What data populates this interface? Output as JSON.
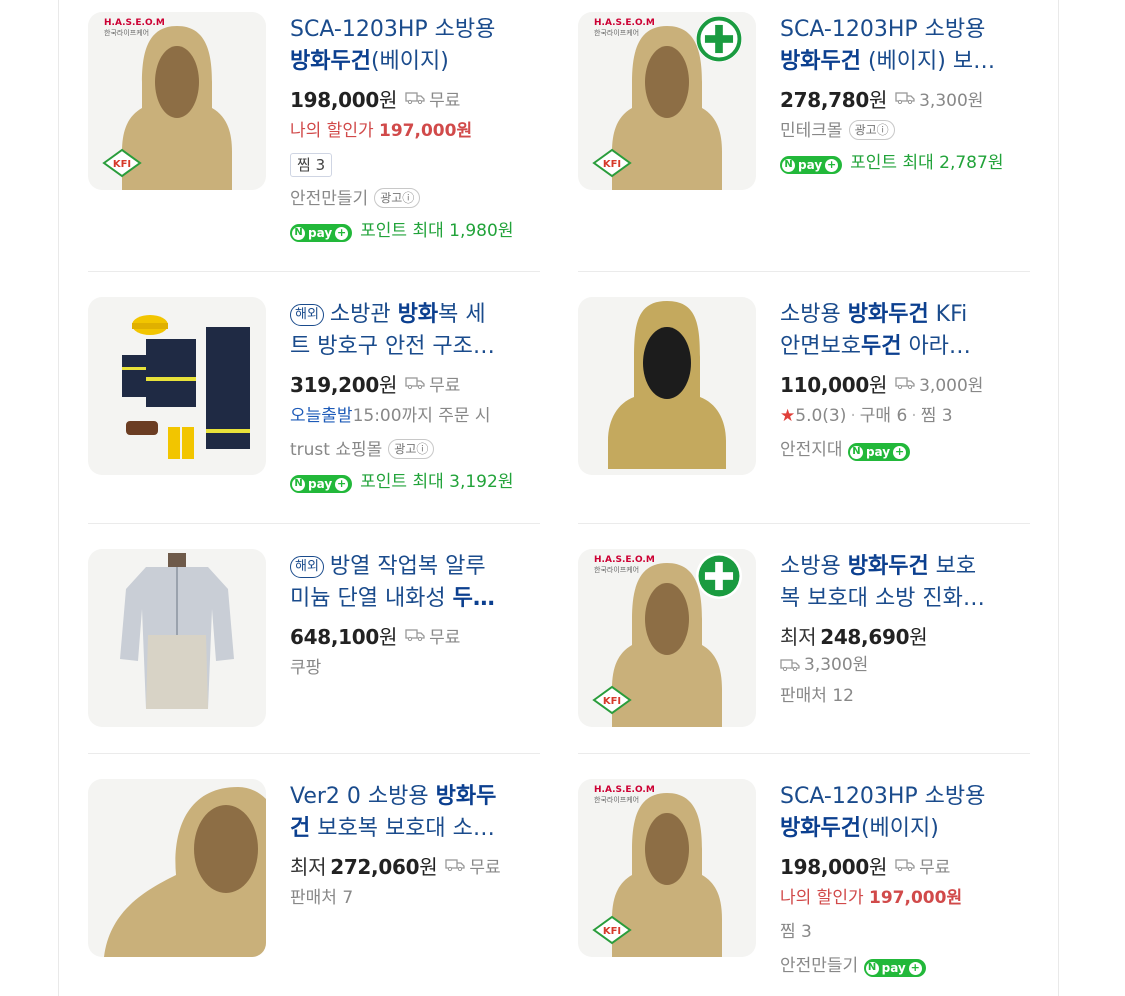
{
  "products": [
    {
      "title_1": "SCA-1203HP 소방용",
      "title_bold_2": "방화두건",
      "title_rest_2": "(베이지)",
      "price": "198,000",
      "won": "원",
      "shipping": "무료",
      "discount_label": "나의 할인가",
      "discount_price": "197,000원",
      "zzim": "찜 3",
      "seller": "안전만들기",
      "ad": "광고ⓘ",
      "npay": "pay",
      "points": "포인트 최대 1,980원"
    },
    {
      "title_1": "SCA-1203HP 소방용",
      "title_bold_2": "방화두건",
      "title_rest_2": " (베이지) 보…",
      "price": "278,780",
      "won": "원",
      "shipping": "3,300원",
      "seller": "민테크몰",
      "ad": "광고ⓘ",
      "npay": "pay",
      "points": "포인트 최대 2,787원"
    },
    {
      "overseas": "해외",
      "title_1a": "소방관 ",
      "title_bold_1": "방화",
      "title_1b": "복 세",
      "title_2": "트 방호구 안전 구조…",
      "price": "319,200",
      "won": "원",
      "shipping": "무료",
      "today_label": "오늘출발",
      "today_rest": "15:00까지 주문 시",
      "seller": "trust 쇼핑몰",
      "ad": "광고ⓘ",
      "npay": "pay",
      "points": "포인트 최대 3,192원"
    },
    {
      "title_1a": "소방용 ",
      "title_bold_1": "방화두건",
      "title_1b": " KFi",
      "title_2a": "안면보호",
      "title_bold_2": "두건",
      "title_2b": " 아라…",
      "price": "110,000",
      "won": "원",
      "shipping": "3,000원",
      "rating": "5.0(3)",
      "purchases": "구매 6",
      "zzim": "찜 3",
      "seller": "안전지대",
      "npay": "pay"
    },
    {
      "overseas": "해외",
      "title_1": "방열 작업복 알루",
      "title_2a": "미늄 단열 내화성 ",
      "title_bold_2": "두…",
      "price": "648,100",
      "won": "원",
      "shipping": "무료",
      "seller": "쿠팡"
    },
    {
      "title_1a": "소방용 ",
      "title_bold_1": "방화두건",
      "title_1b": " 보호",
      "title_2": "복 보호대 소방 진화…",
      "lowest": "최저",
      "price": "248,690",
      "won": "원",
      "shipping": "3,300원",
      "sellers": "판매처 12"
    },
    {
      "title_1a": "Ver2 0 소방용 ",
      "title_bold_1": "방화두",
      "title_bold_2": "건",
      "title_2b": " 보호복 보호대 소…",
      "lowest": "최저",
      "price": "272,060",
      "won": "원",
      "shipping": "무료",
      "sellers": "판매처 7"
    },
    {
      "title_1": "SCA-1203HP 소방용",
      "title_bold_2": "방화두건",
      "title_rest_2": "(베이지)",
      "price": "198,000",
      "won": "원",
      "shipping": "무료",
      "discount_label": "나의 할인가",
      "discount_price": "197,000원",
      "zzim": "찜 3",
      "seller": "안전만들기",
      "npay": "pay"
    }
  ],
  "thumb_badges": {
    "kfi": "KFI",
    "brand_1": "H.A.S.E.O.M",
    "brand_2": "한국라이프케어"
  },
  "colors": {
    "title": "#1a4b8c",
    "npay": "#22b83a",
    "discount": "#d14a4a"
  }
}
